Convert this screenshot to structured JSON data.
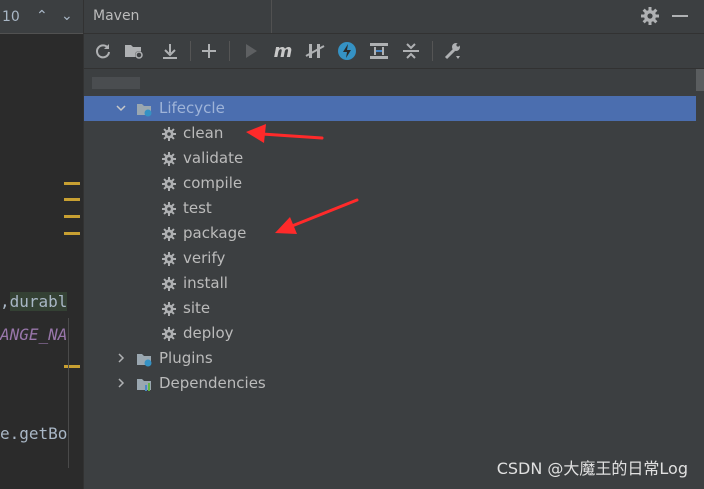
{
  "editor": {
    "line_number": "10",
    "code_line1_prefix": ",",
    "code_line1_highlight": "durabl",
    "code_line2": "ANGE_NA",
    "code_line3": "e.getBo"
  },
  "maven": {
    "title": "Maven"
  },
  "toolbar": {
    "m_glyph": "m"
  },
  "tree": {
    "lifecycle": {
      "label": "Lifecycle",
      "expanded": true,
      "selected": true
    },
    "goals": [
      {
        "label": "clean"
      },
      {
        "label": "validate"
      },
      {
        "label": "compile"
      },
      {
        "label": "test"
      },
      {
        "label": "package"
      },
      {
        "label": "verify"
      },
      {
        "label": "install"
      },
      {
        "label": "site"
      },
      {
        "label": "deploy"
      }
    ],
    "plugins": {
      "label": "Plugins",
      "expanded": false
    },
    "dependencies": {
      "label": "Dependencies",
      "expanded": false
    }
  },
  "colors": {
    "selection": "#4b6eaf",
    "annotation_arrow": "#ff2a2a",
    "panel_bg": "#3c3f41"
  },
  "icons": {
    "goal": "gear-icon",
    "lifecycle": "lifecycle-folder-icon",
    "plugins": "plugins-folder-icon",
    "dependencies": "dependencies-folder-icon"
  },
  "watermark": "CSDN @大魔王的日常Log"
}
